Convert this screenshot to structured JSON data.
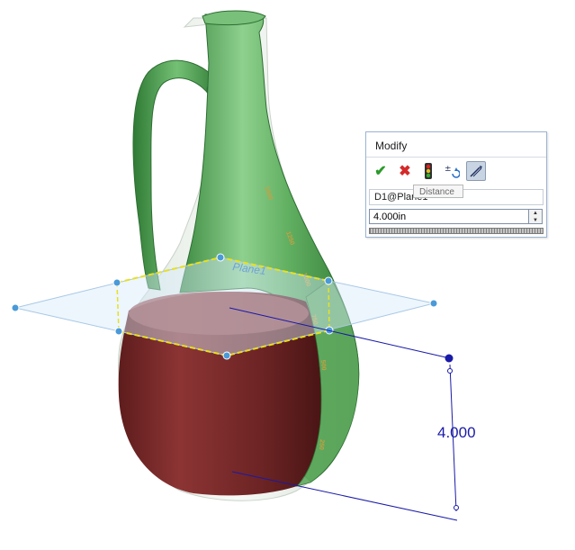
{
  "dialog": {
    "title": "Modify",
    "tooltip": "Distance",
    "dimension_name": "D1@Plane1",
    "value": "4.000in",
    "icons": {
      "ok": "checkmark-icon",
      "cancel": "x-icon",
      "rebuild": "traffic-light-icon",
      "regenerate": "plus-minus-rebuild-icon",
      "mark_dimension": "mark-dimension-icon"
    }
  },
  "scene": {
    "dimension_label": "4.000",
    "plane_label": "Plane1",
    "graduations": [
      "1500",
      "1250",
      "1000",
      "750",
      "500",
      "250"
    ],
    "colors": {
      "glass": "#5faa5f",
      "liquid": "#7a2828",
      "plane_fill": "#d8ecfa",
      "plane_edge": "#f0e020",
      "dimension": "#1a1aa8",
      "handle": "#4a9ad8"
    }
  }
}
